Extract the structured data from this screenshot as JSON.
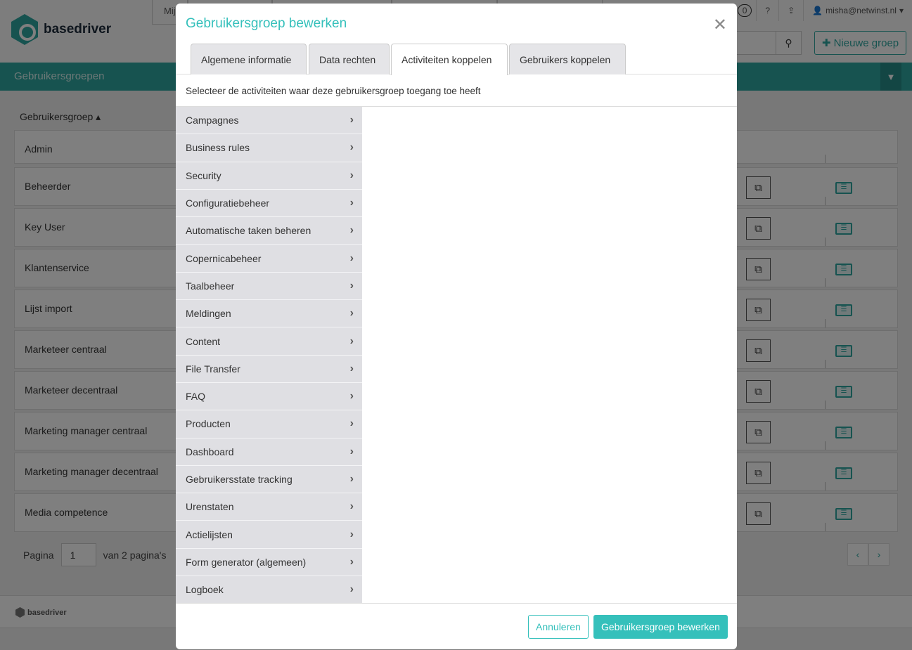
{
  "app": {
    "logo_text": "basedriver",
    "brand_color": "#2fa6a0",
    "accent_color": "#35c0bb"
  },
  "topnav": {
    "items": [
      "Mij"
    ]
  },
  "userbar": {
    "badge": "0",
    "user": "misha@netwinst.nl"
  },
  "toolbar": {
    "new_group_label": "Nieuwe groep"
  },
  "section": {
    "title": "Gebruikersgroepen"
  },
  "table": {
    "column_header": "Gebruikersgroep",
    "rows": [
      "Admin",
      "Beheerder",
      "Key User",
      "Klantenservice",
      "Lijst import",
      "Marketeer centraal",
      "Marketeer decentraal",
      "Marketing manager centraal",
      "Marketing manager decentraal",
      "Media competence"
    ]
  },
  "pager": {
    "label": "Pagina",
    "page": "1",
    "of_label": "van 2 pagina's",
    "prev": "‹",
    "next": "›"
  },
  "footer": {
    "logo_text": "basedriver"
  },
  "modal": {
    "title": "Gebruikersgroep bewerken",
    "tabs": [
      {
        "label": "Algemene informatie",
        "active": false
      },
      {
        "label": "Data rechten",
        "active": false
      },
      {
        "label": "Activiteiten koppelen",
        "active": true
      },
      {
        "label": "Gebruikers koppelen",
        "active": false
      }
    ],
    "description": "Selecteer de activiteiten waar deze gebruikersgroep toegang toe heeft",
    "activities": [
      "Campagnes",
      "Business rules",
      "Security",
      "Configuratiebeheer",
      "Automatische taken beheren",
      "Copernicabeheer",
      "Taalbeheer",
      "Meldingen",
      "Content",
      "File Transfer",
      "FAQ",
      "Producten",
      "Dashboard",
      "Gebruikersstate tracking",
      "Urenstaten",
      "Actielijsten",
      "Form generator (algemeen)",
      "Logboek"
    ],
    "cancel_label": "Annuleren",
    "submit_label": "Gebruikersgroep bewerken"
  }
}
